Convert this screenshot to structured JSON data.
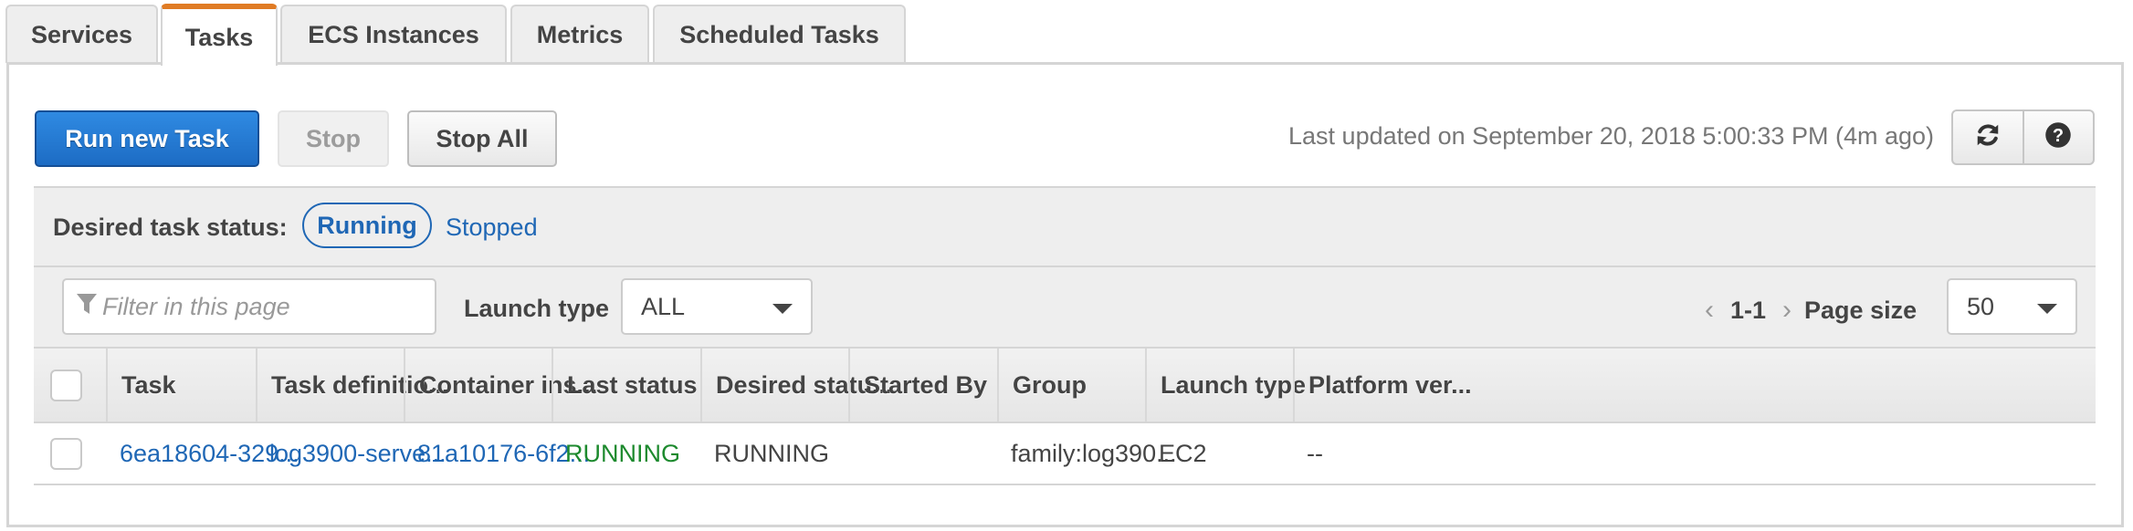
{
  "tabs": [
    {
      "label": "Services",
      "active": false
    },
    {
      "label": "Tasks",
      "active": true
    },
    {
      "label": "ECS Instances",
      "active": false
    },
    {
      "label": "Metrics",
      "active": false
    },
    {
      "label": "Scheduled Tasks",
      "active": false
    }
  ],
  "toolbar": {
    "run_new_task_label": "Run new Task",
    "stop_label": "Stop",
    "stop_all_label": "Stop All",
    "last_updated": "Last updated on September 20, 2018 5:00:33 PM (4m ago)",
    "refresh_icon": "refresh-icon",
    "help_icon": "help-icon"
  },
  "status_filter": {
    "label": "Desired task status:",
    "options": [
      "Running",
      "Stopped"
    ],
    "selected": "Running"
  },
  "filter": {
    "placeholder": "Filter in this page",
    "value": "",
    "icon": "filter-icon",
    "launch_type_label": "Launch type",
    "launch_type_value": "ALL"
  },
  "pagination": {
    "range": "1-1",
    "page_size_label": "Page size",
    "page_size_value": "50"
  },
  "table": {
    "columns": [
      "Task",
      "Task definitio...",
      "Container ins...",
      "Last status",
      "Desired statu...",
      "Started By",
      "Group",
      "Launch type",
      "Platform ver..."
    ],
    "rows": [
      {
        "task": "6ea18604-329...",
        "task_definition": "log3900-serve...",
        "container_instance": "81a10176-6f2...",
        "last_status": "RUNNING",
        "desired_status": "RUNNING",
        "started_by": "",
        "group": "family:log390...",
        "launch_type": "EC2",
        "platform_version": "--"
      }
    ]
  },
  "colors": {
    "accent_tab": "#e07b24",
    "primary_button": "#1f6ec7",
    "link": "#1f67b5",
    "status_running": "#1d8a2e"
  }
}
